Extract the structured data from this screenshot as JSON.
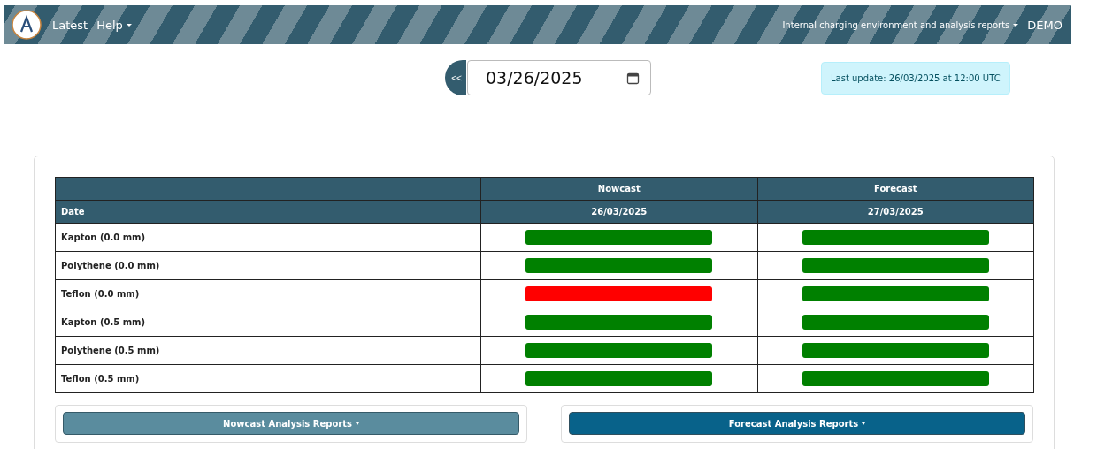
{
  "navbar": {
    "links": [
      {
        "label": "Latest",
        "dropdown": false
      },
      {
        "label": "Help",
        "dropdown": true
      }
    ],
    "right_menu": {
      "label": "Internal charging environment and analysis reports",
      "dropdown": true
    },
    "badge": "DEMO"
  },
  "date_picker": {
    "back_button": "<<",
    "value": "03/26/2025"
  },
  "last_update": "Last update: 26/03/2025 at 12:00 UTC",
  "table": {
    "columns": [
      "Nowcast",
      "Forecast"
    ],
    "date_label": "Date",
    "dates": [
      "26/03/2025",
      "27/03/2025"
    ],
    "rows": [
      {
        "label": "Kapton (0.0 mm)",
        "cells": [
          {
            "color": "#008000"
          },
          {
            "color": "#008000"
          }
        ]
      },
      {
        "label": "Polythene (0.0 mm)",
        "cells": [
          {
            "color": "#008000"
          },
          {
            "color": "#008000"
          }
        ]
      },
      {
        "label": "Teflon (0.0 mm)",
        "cells": [
          {
            "color": "#ff0000"
          },
          {
            "color": "#008000"
          }
        ]
      },
      {
        "label": "Kapton (0.5 mm)",
        "cells": [
          {
            "color": "#008000"
          },
          {
            "color": "#008000"
          }
        ]
      },
      {
        "label": "Polythene (0.5 mm)",
        "cells": [
          {
            "color": "#008000"
          },
          {
            "color": "#008000"
          }
        ]
      },
      {
        "label": "Teflon (0.5 mm)",
        "cells": [
          {
            "color": "#008000"
          },
          {
            "color": "#008000"
          }
        ]
      }
    ]
  },
  "report_buttons": [
    {
      "label": "Nowcast Analysis Reports",
      "disabled": true
    },
    {
      "label": "Forecast Analysis Reports",
      "disabled": false
    }
  ]
}
